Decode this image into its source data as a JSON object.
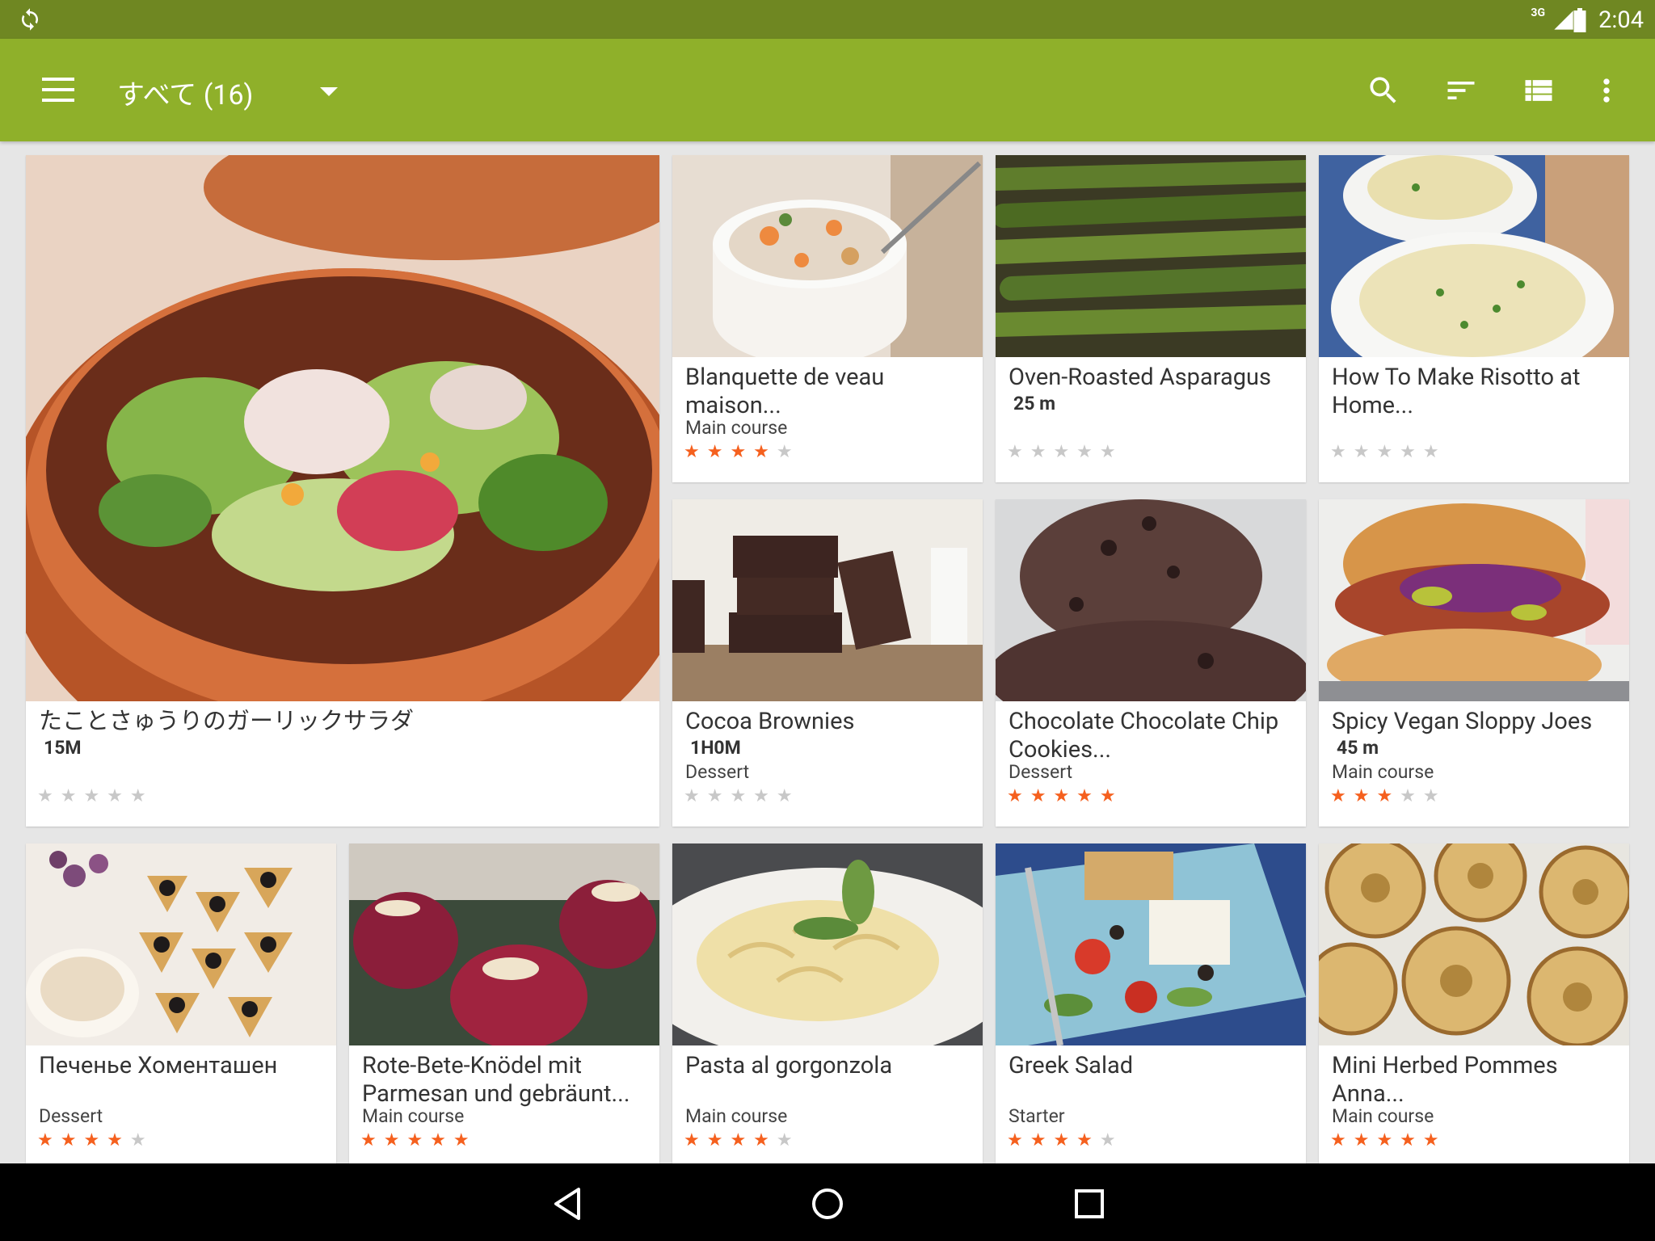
{
  "status": {
    "network": "3G",
    "time": "2:04"
  },
  "toolbar": {
    "title": "すべて (16)"
  },
  "colors": {
    "status_bar": "#6f8722",
    "toolbar": "#8fb02a",
    "star_on": "#f5601e",
    "star_off": "#c8c8c8",
    "background": "#e6e6e6"
  },
  "recipes": [
    {
      "title": "たことさゅうりのガーリックサラダ",
      "meta": "15M",
      "category": "",
      "rating": 0
    },
    {
      "title": "Blanquette de veau maison...",
      "meta": "",
      "category": "Main course",
      "rating": 4
    },
    {
      "title": "Oven-Roasted Asparagus",
      "meta": "25 m",
      "category": "",
      "rating": 0
    },
    {
      "title": "How To Make Risotto at Home...",
      "meta": "",
      "category": "",
      "rating": 0
    },
    {
      "title": "Cocoa Brownies",
      "meta": "1H0M",
      "category": "Dessert",
      "rating": 0
    },
    {
      "title": "Chocolate Chocolate Chip Cookies...",
      "meta": "",
      "category": "Dessert",
      "rating": 5
    },
    {
      "title": "Spicy Vegan Sloppy Joes",
      "meta": "45 m",
      "category": "Main course",
      "rating": 3
    },
    {
      "title": "Печенье Хоменташен",
      "meta": "",
      "category": "Dessert",
      "rating": 4
    },
    {
      "title": "Rote-Bete-Knödel mit Parmesan und gebräunt...",
      "meta": "",
      "category": "Main course",
      "rating": 5
    },
    {
      "title": "Pasta al gorgonzola",
      "meta": "",
      "category": "Main course",
      "rating": 4
    },
    {
      "title": "Greek Salad",
      "meta": "",
      "category": "Starter",
      "rating": 4
    },
    {
      "title": "Mini Herbed Pommes Anna...",
      "meta": "",
      "category": "Main course",
      "rating": 5
    }
  ]
}
